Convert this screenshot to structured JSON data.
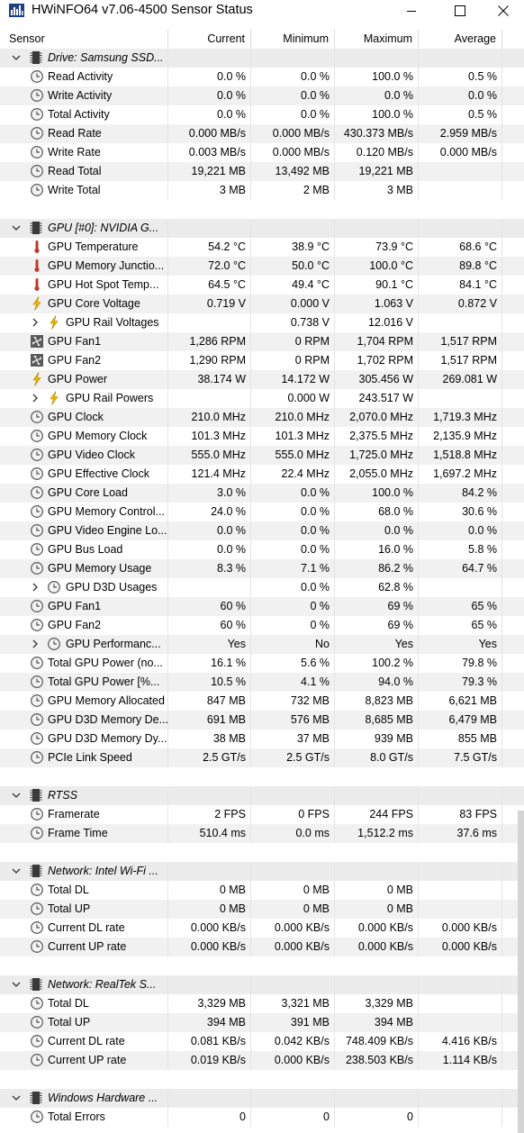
{
  "window": {
    "title": "HWiNFO64 v7.06-4500 Sensor Status",
    "minimize_icon": "minimize-icon",
    "maximize_icon": "maximize-icon",
    "close_icon": "close-icon"
  },
  "columns": [
    "Sensor",
    "Current",
    "Minimum",
    "Maximum",
    "Average"
  ],
  "rows": [
    {
      "type": "group",
      "name": "Drive: Samsung SSD..."
    },
    {
      "type": "sensor",
      "icon": "clock",
      "name": "Read Activity",
      "cur": "0.0 %",
      "min": "0.0 %",
      "max": "100.0 %",
      "avg": "0.5 %"
    },
    {
      "type": "sensor",
      "icon": "clock",
      "name": "Write Activity",
      "cur": "0.0 %",
      "min": "0.0 %",
      "max": "0.0 %",
      "avg": "0.0 %"
    },
    {
      "type": "sensor",
      "icon": "clock",
      "name": "Total Activity",
      "cur": "0.0 %",
      "min": "0.0 %",
      "max": "100.0 %",
      "avg": "0.5 %"
    },
    {
      "type": "sensor",
      "icon": "clock",
      "name": "Read Rate",
      "cur": "0.000 MB/s",
      "min": "0.000 MB/s",
      "max": "430.373 MB/s",
      "avg": "2.959 MB/s"
    },
    {
      "type": "sensor",
      "icon": "clock",
      "name": "Write Rate",
      "cur": "0.003 MB/s",
      "min": "0.000 MB/s",
      "max": "0.120 MB/s",
      "avg": "0.000 MB/s"
    },
    {
      "type": "sensor",
      "icon": "clock",
      "name": "Read Total",
      "cur": "19,221 MB",
      "min": "13,492 MB",
      "max": "19,221 MB",
      "avg": ""
    },
    {
      "type": "sensor",
      "icon": "clock",
      "name": "Write Total",
      "cur": "3 MB",
      "min": "2 MB",
      "max": "3 MB",
      "avg": ""
    },
    {
      "type": "spacer"
    },
    {
      "type": "group",
      "name": "GPU [#0]: NVIDIA G..."
    },
    {
      "type": "sensor",
      "icon": "thermo",
      "name": "GPU Temperature",
      "cur": "54.2 °C",
      "min": "38.9 °C",
      "max": "73.9 °C",
      "avg": "68.6 °C"
    },
    {
      "type": "sensor",
      "icon": "thermo",
      "name": "GPU Memory Junctio...",
      "cur": "72.0 °C",
      "min": "50.0 °C",
      "max": "100.0 °C",
      "avg": "89.8 °C"
    },
    {
      "type": "sensor",
      "icon": "thermo",
      "name": "GPU Hot Spot Temp...",
      "cur": "64.5 °C",
      "min": "49.4 °C",
      "max": "90.1 °C",
      "avg": "84.1 °C"
    },
    {
      "type": "sensor",
      "icon": "bolt",
      "name": "GPU Core Voltage",
      "cur": "0.719 V",
      "min": "0.000 V",
      "max": "1.063 V",
      "avg": "0.872 V"
    },
    {
      "type": "sensor",
      "icon": "bolt",
      "sub": true,
      "name": "GPU Rail Voltages",
      "cur": "",
      "min": "0.738 V",
      "max": "12.016 V",
      "avg": ""
    },
    {
      "type": "sensor",
      "icon": "fan",
      "name": "GPU Fan1",
      "cur": "1,286 RPM",
      "min": "0 RPM",
      "max": "1,704 RPM",
      "avg": "1,517 RPM"
    },
    {
      "type": "sensor",
      "icon": "fan",
      "name": "GPU Fan2",
      "cur": "1,290 RPM",
      "min": "0 RPM",
      "max": "1,702 RPM",
      "avg": "1,517 RPM"
    },
    {
      "type": "sensor",
      "icon": "bolt",
      "name": "GPU Power",
      "cur": "38.174 W",
      "min": "14.172 W",
      "max": "305.456 W",
      "avg": "269.081 W"
    },
    {
      "type": "sensor",
      "icon": "bolt",
      "sub": true,
      "name": "GPU Rail Powers",
      "cur": "",
      "min": "0.000 W",
      "max": "243.517 W",
      "avg": ""
    },
    {
      "type": "sensor",
      "icon": "clock",
      "name": "GPU Clock",
      "cur": "210.0 MHz",
      "min": "210.0 MHz",
      "max": "2,070.0 MHz",
      "avg": "1,719.3 MHz"
    },
    {
      "type": "sensor",
      "icon": "clock",
      "name": "GPU Memory Clock",
      "cur": "101.3 MHz",
      "min": "101.3 MHz",
      "max": "2,375.5 MHz",
      "avg": "2,135.9 MHz"
    },
    {
      "type": "sensor",
      "icon": "clock",
      "name": "GPU Video Clock",
      "cur": "555.0 MHz",
      "min": "555.0 MHz",
      "max": "1,725.0 MHz",
      "avg": "1,518.8 MHz"
    },
    {
      "type": "sensor",
      "icon": "clock",
      "name": "GPU Effective Clock",
      "cur": "121.4 MHz",
      "min": "22.4 MHz",
      "max": "2,055.0 MHz",
      "avg": "1,697.2 MHz"
    },
    {
      "type": "sensor",
      "icon": "clock",
      "name": "GPU Core Load",
      "cur": "3.0 %",
      "min": "0.0 %",
      "max": "100.0 %",
      "avg": "84.2 %"
    },
    {
      "type": "sensor",
      "icon": "clock",
      "name": "GPU Memory Control...",
      "cur": "24.0 %",
      "min": "0.0 %",
      "max": "68.0 %",
      "avg": "30.6 %"
    },
    {
      "type": "sensor",
      "icon": "clock",
      "name": "GPU Video Engine Lo...",
      "cur": "0.0 %",
      "min": "0.0 %",
      "max": "0.0 %",
      "avg": "0.0 %"
    },
    {
      "type": "sensor",
      "icon": "clock",
      "name": "GPU Bus Load",
      "cur": "0.0 %",
      "min": "0.0 %",
      "max": "16.0 %",
      "avg": "5.8 %"
    },
    {
      "type": "sensor",
      "icon": "clock",
      "name": "GPU Memory Usage",
      "cur": "8.3 %",
      "min": "7.1 %",
      "max": "86.2 %",
      "avg": "64.7 %"
    },
    {
      "type": "sensor",
      "icon": "clock",
      "sub": true,
      "name": "GPU D3D Usages",
      "cur": "",
      "min": "0.0 %",
      "max": "62.8 %",
      "avg": ""
    },
    {
      "type": "sensor",
      "icon": "clock",
      "name": "GPU Fan1",
      "cur": "60 %",
      "min": "0 %",
      "max": "69 %",
      "avg": "65 %"
    },
    {
      "type": "sensor",
      "icon": "clock",
      "name": "GPU Fan2",
      "cur": "60 %",
      "min": "0 %",
      "max": "69 %",
      "avg": "65 %"
    },
    {
      "type": "sensor",
      "icon": "clock",
      "sub": true,
      "name": "GPU Performanc...",
      "cur": "Yes",
      "min": "No",
      "max": "Yes",
      "avg": "Yes"
    },
    {
      "type": "sensor",
      "icon": "clock",
      "name": "Total GPU Power (no...",
      "cur": "16.1 %",
      "min": "5.6 %",
      "max": "100.2 %",
      "avg": "79.8 %"
    },
    {
      "type": "sensor",
      "icon": "clock",
      "name": "Total GPU Power [%...",
      "cur": "10.5 %",
      "min": "4.1 %",
      "max": "94.0 %",
      "avg": "79.3 %"
    },
    {
      "type": "sensor",
      "icon": "clock",
      "name": "GPU Memory Allocated",
      "cur": "847 MB",
      "min": "732 MB",
      "max": "8,823 MB",
      "avg": "6,621 MB"
    },
    {
      "type": "sensor",
      "icon": "clock",
      "name": "GPU D3D Memory De...",
      "cur": "691 MB",
      "min": "576 MB",
      "max": "8,685 MB",
      "avg": "6,479 MB"
    },
    {
      "type": "sensor",
      "icon": "clock",
      "name": "GPU D3D Memory Dy...",
      "cur": "38 MB",
      "min": "37 MB",
      "max": "939 MB",
      "avg": "855 MB"
    },
    {
      "type": "sensor",
      "icon": "clock",
      "name": "PCIe Link Speed",
      "cur": "2.5 GT/s",
      "min": "2.5 GT/s",
      "max": "8.0 GT/s",
      "avg": "7.5 GT/s"
    },
    {
      "type": "spacer"
    },
    {
      "type": "group",
      "name": "RTSS"
    },
    {
      "type": "sensor",
      "icon": "clock",
      "name": "Framerate",
      "cur": "2 FPS",
      "min": "0 FPS",
      "max": "244 FPS",
      "avg": "83 FPS"
    },
    {
      "type": "sensor",
      "icon": "clock",
      "name": "Frame Time",
      "cur": "510.4 ms",
      "min": "0.0 ms",
      "max": "1,512.2 ms",
      "avg": "37.6 ms"
    },
    {
      "type": "spacer"
    },
    {
      "type": "group",
      "name": "Network: Intel Wi-Fi ..."
    },
    {
      "type": "sensor",
      "icon": "clock",
      "name": "Total DL",
      "cur": "0 MB",
      "min": "0 MB",
      "max": "0 MB",
      "avg": ""
    },
    {
      "type": "sensor",
      "icon": "clock",
      "name": "Total UP",
      "cur": "0 MB",
      "min": "0 MB",
      "max": "0 MB",
      "avg": ""
    },
    {
      "type": "sensor",
      "icon": "clock",
      "name": "Current DL rate",
      "cur": "0.000 KB/s",
      "min": "0.000 KB/s",
      "max": "0.000 KB/s",
      "avg": "0.000 KB/s"
    },
    {
      "type": "sensor",
      "icon": "clock",
      "name": "Current UP rate",
      "cur": "0.000 KB/s",
      "min": "0.000 KB/s",
      "max": "0.000 KB/s",
      "avg": "0.000 KB/s"
    },
    {
      "type": "spacer"
    },
    {
      "type": "group",
      "name": "Network: RealTek S..."
    },
    {
      "type": "sensor",
      "icon": "clock",
      "name": "Total DL",
      "cur": "3,329 MB",
      "min": "3,321 MB",
      "max": "3,329 MB",
      "avg": ""
    },
    {
      "type": "sensor",
      "icon": "clock",
      "name": "Total UP",
      "cur": "394 MB",
      "min": "391 MB",
      "max": "394 MB",
      "avg": ""
    },
    {
      "type": "sensor",
      "icon": "clock",
      "name": "Current DL rate",
      "cur": "0.081 KB/s",
      "min": "0.042 KB/s",
      "max": "748.409 KB/s",
      "avg": "4.416 KB/s"
    },
    {
      "type": "sensor",
      "icon": "clock",
      "name": "Current UP rate",
      "cur": "0.019 KB/s",
      "min": "0.000 KB/s",
      "max": "238.503 KB/s",
      "avg": "1.114 KB/s"
    },
    {
      "type": "spacer"
    },
    {
      "type": "group",
      "name": "Windows Hardware ..."
    },
    {
      "type": "sensor",
      "icon": "clock",
      "name": "Total Errors",
      "cur": "0",
      "min": "0",
      "max": "0",
      "avg": ""
    }
  ],
  "colors": {
    "group_bg": "#ececec",
    "alt_bg": "#f1f1f1",
    "thermo": "#c0392b",
    "bolt": "#f0b400"
  }
}
